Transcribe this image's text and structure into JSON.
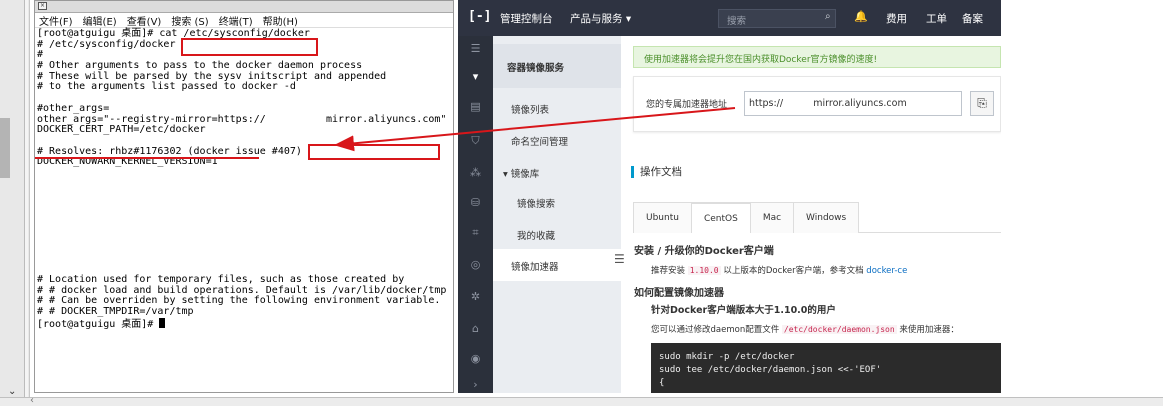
{
  "terminal": {
    "menu": [
      "文件(F)",
      "编辑(E)",
      "查看(V)",
      "搜索 (S)",
      "终端(T)",
      "帮助(H)"
    ],
    "lines": [
      "[root@atguigu 桌面]# cat /etc/sysconfig/docker",
      "# /etc/sysconfig/docker",
      "#",
      "# Other arguments to pass to the docker daemon process",
      "# These will be parsed by the sysv initscript and appended",
      "# to the arguments list passed to docker -d",
      "",
      "#other_args=",
      "other_args=\"--registry-mirror=https://          mirror.aliyuncs.com\"",
      "DOCKER_CERT_PATH=/etc/docker",
      "",
      "# Resolves: rhbz#1176302 (docker issue #407)",
      "DOCKER_NOWARN_KERNEL_VERSION=1",
      "",
      "",
      "",
      "",
      "",
      "",
      "",
      "",
      "",
      "",
      "# Location used for temporary files, such as those created by",
      "# # docker load and build operations. Default is /var/lib/docker/tmp",
      "# # Can be overriden by setting the following environment variable.",
      "# # DOCKER_TMPDIR=/var/tmp",
      "[root@atguigu 桌面]# "
    ]
  },
  "console": {
    "topbar": {
      "console": "管理控制台",
      "products": "产品与服务 ▾",
      "search_placeholder": "搜索",
      "fees": "费用",
      "tickets": "工单",
      "filing": "备案"
    },
    "nav": {
      "title": "容器镜像服务",
      "items": [
        "镜像列表",
        "命名空间管理",
        "镜像库",
        "镜像搜索",
        "我的收藏",
        "镜像加速器"
      ],
      "active": "镜像加速器"
    },
    "notice": "使用加速器将会提升您在国内获取Docker官方镜像的速度!",
    "accelerator": {
      "label": "您的专属加速器地址",
      "value": "https://          mirror.aliyuncs.com"
    },
    "doc_title": "操作文档",
    "tabs": [
      "Ubuntu",
      "CentOS",
      "Mac",
      "Windows"
    ],
    "active_tab": "CentOS",
    "install_heading": "安装 / 升级你的Docker客户端",
    "install_text_pre": "推荐安装",
    "install_version": "1.10.0",
    "install_text_mid": "以上版本的Docker客户端，参考文档",
    "install_link": "docker-ce",
    "config_heading": "如何配置镜像加速器",
    "config_sub": "针对Docker客户端版本大于1.10.0的用户",
    "config_text_pre": "您可以通过修改daemon配置文件",
    "config_path": "/etc/docker/daemon.json",
    "config_text_post": "来使用加速器：",
    "code_lines": [
      "sudo mkdir -p /etc/docker",
      "sudo tee /etc/docker/daemon.json <<-'EOF'",
      "{"
    ]
  },
  "colors": {
    "annotation_red": "#d8161a",
    "topbar": "#2e3341",
    "accent": "#0099cc"
  }
}
